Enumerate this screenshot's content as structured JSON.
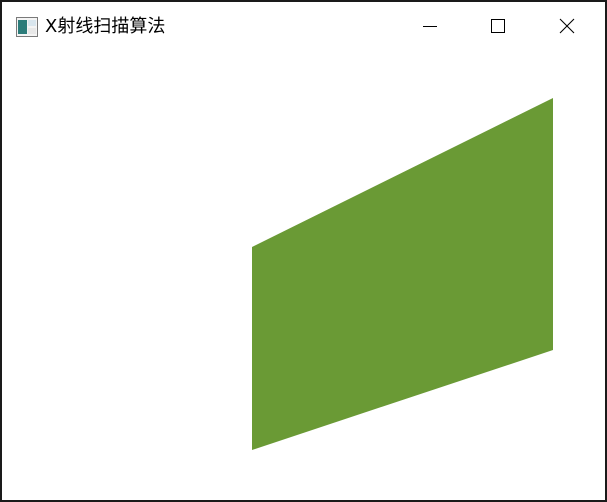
{
  "window": {
    "title": "X射线扫描算法",
    "icon": "app-window-icon",
    "controls": {
      "minimize_icon": "minimize-icon",
      "maximize_icon": "maximize-icon",
      "close_icon": "close-icon"
    }
  },
  "canvas": {
    "shape": "filled-parallelogram",
    "fill_color": "#6a9a35",
    "background_color": "#ffffff"
  }
}
